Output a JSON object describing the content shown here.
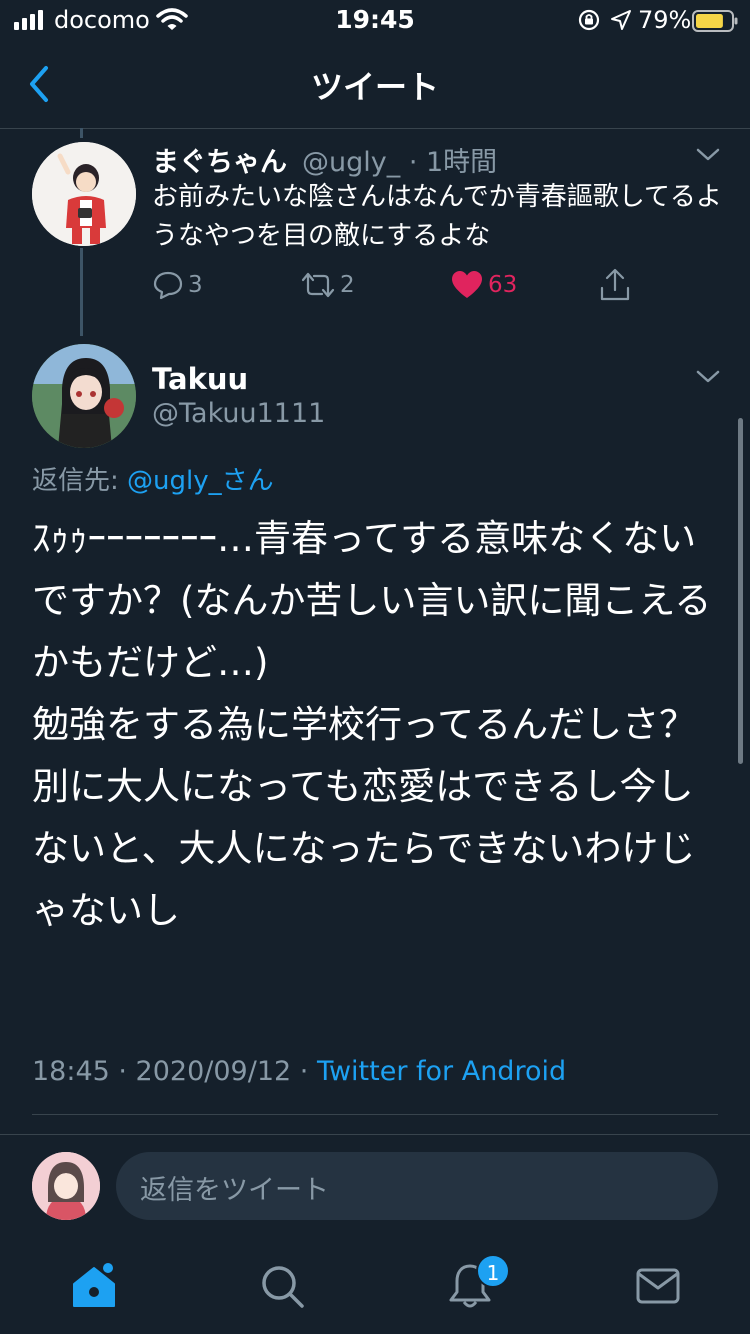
{
  "status_bar": {
    "carrier": "docomo",
    "time": "19:45",
    "battery_percent": "79%",
    "battery_level": 0.79
  },
  "header": {
    "title": "ツイート"
  },
  "parent_tweet": {
    "name": "まぐちゃん",
    "handle_time": "@ugly_ · 1時間",
    "text": "お前みたいな陰さんはなんでか青春謳歌してるようなやつを目の敵にするよな",
    "replies": "3",
    "retweets": "2",
    "likes": "63"
  },
  "main_tweet": {
    "name": "Takuu",
    "handle": "@Takuu1111",
    "reply_prefix": "返信先: ",
    "reply_mention": "@ugly_さん",
    "text": "ｽｩｩｰｰｰｰｰｰｰ…青春ってする意味なくないですか？(なんか苦しい言い訳に聞こえるかもだけど…)\n勉強をする為に学校行ってるんだしさ？\n別に大人になっても恋愛はできるし今しないと、大人になったらできないわけじゃないし",
    "date": "18:45 · 2020/09/12 · ",
    "source": "Twitter for Android"
  },
  "reply_box": {
    "placeholder": "返信をツイート"
  },
  "tab_bar": {
    "notification_badge": "1"
  },
  "colors": {
    "background": "#15202b",
    "accent": "#1da1f2",
    "like": "#e0245e",
    "secondary_text": "#8899a6"
  }
}
